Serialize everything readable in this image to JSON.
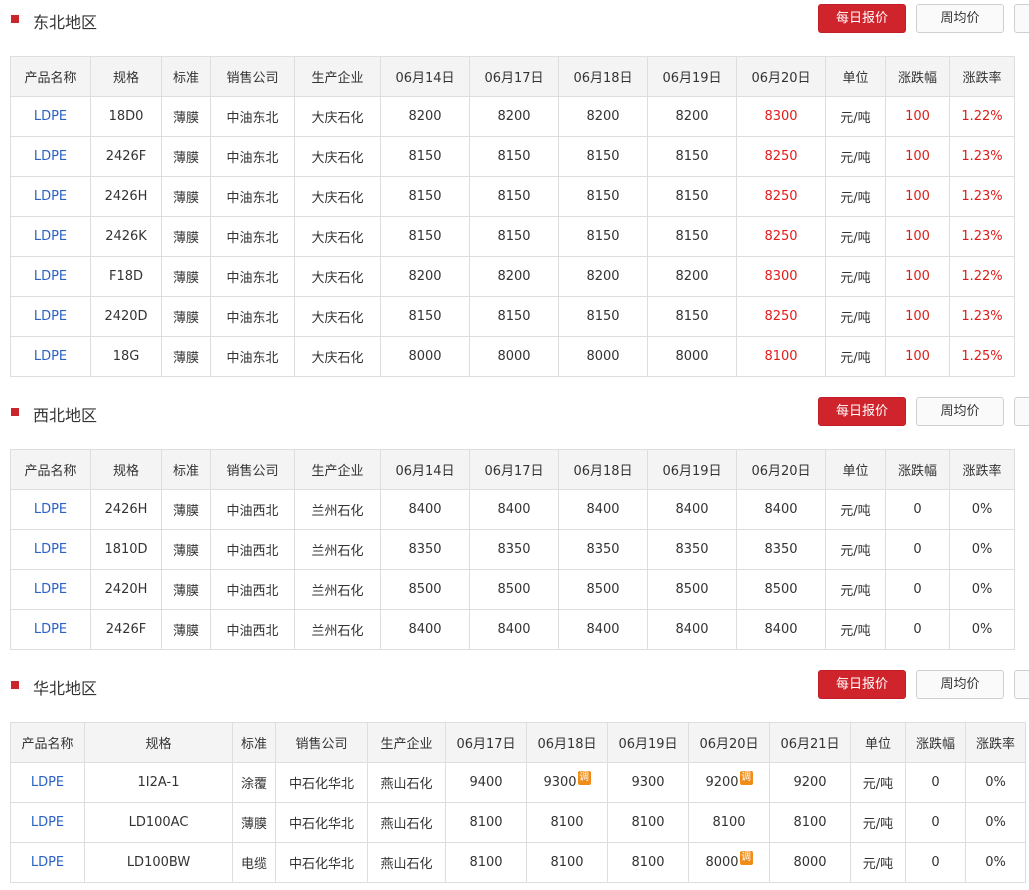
{
  "buttons": {
    "daily": "每日报价",
    "weekly": "周均价"
  },
  "sections": [
    {
      "title": "东北地区",
      "headers": [
        "产品名称",
        "规格",
        "标准",
        "销售公司",
        "生产企业",
        "06月14日",
        "06月17日",
        "06月18日",
        "06月19日",
        "06月20日",
        "单位",
        "涨跌幅",
        "涨跌率"
      ],
      "rows": [
        [
          "LDPE",
          "18D0",
          "薄膜",
          "中油东北",
          "大庆石化",
          "8200",
          "8200",
          "8200",
          "8200",
          "8300",
          "元/吨",
          "100",
          "1.22%"
        ],
        [
          "LDPE",
          "2426F",
          "薄膜",
          "中油东北",
          "大庆石化",
          "8150",
          "8150",
          "8150",
          "8150",
          "8250",
          "元/吨",
          "100",
          "1.23%"
        ],
        [
          "LDPE",
          "2426H",
          "薄膜",
          "中油东北",
          "大庆石化",
          "8150",
          "8150",
          "8150",
          "8150",
          "8250",
          "元/吨",
          "100",
          "1.23%"
        ],
        [
          "LDPE",
          "2426K",
          "薄膜",
          "中油东北",
          "大庆石化",
          "8150",
          "8150",
          "8150",
          "8150",
          "8250",
          "元/吨",
          "100",
          "1.23%"
        ],
        [
          "LDPE",
          "F18D",
          "薄膜",
          "中油东北",
          "大庆石化",
          "8200",
          "8200",
          "8200",
          "8200",
          "8300",
          "元/吨",
          "100",
          "1.22%"
        ],
        [
          "LDPE",
          "2420D",
          "薄膜",
          "中油东北",
          "大庆石化",
          "8150",
          "8150",
          "8150",
          "8150",
          "8250",
          "元/吨",
          "100",
          "1.23%"
        ],
        [
          "LDPE",
          "18G",
          "薄膜",
          "中油东北",
          "大庆石化",
          "8000",
          "8000",
          "8000",
          "8000",
          "8100",
          "元/吨",
          "100",
          "1.25%"
        ]
      ],
      "red_columns": [
        9,
        11,
        12
      ]
    },
    {
      "title": "西北地区",
      "headers": [
        "产品名称",
        "规格",
        "标准",
        "销售公司",
        "生产企业",
        "06月14日",
        "06月17日",
        "06月18日",
        "06月19日",
        "06月20日",
        "单位",
        "涨跌幅",
        "涨跌率"
      ],
      "rows": [
        [
          "LDPE",
          "2426H",
          "薄膜",
          "中油西北",
          "兰州石化",
          "8400",
          "8400",
          "8400",
          "8400",
          "8400",
          "元/吨",
          "0",
          "0%"
        ],
        [
          "LDPE",
          "1810D",
          "薄膜",
          "中油西北",
          "兰州石化",
          "8350",
          "8350",
          "8350",
          "8350",
          "8350",
          "元/吨",
          "0",
          "0%"
        ],
        [
          "LDPE",
          "2420H",
          "薄膜",
          "中油西北",
          "兰州石化",
          "8500",
          "8500",
          "8500",
          "8500",
          "8500",
          "元/吨",
          "0",
          "0%"
        ],
        [
          "LDPE",
          "2426F",
          "薄膜",
          "中油西北",
          "兰州石化",
          "8400",
          "8400",
          "8400",
          "8400",
          "8400",
          "元/吨",
          "0",
          "0%"
        ]
      ],
      "red_columns": []
    },
    {
      "title": "华北地区",
      "adjust_badge": "调",
      "headers": [
        "产品名称",
        "规格",
        "标准",
        "销售公司",
        "生产企业",
        "06月17日",
        "06月18日",
        "06月19日",
        "06月20日",
        "06月21日",
        "单位",
        "涨跌幅",
        "涨跌率"
      ],
      "rows": [
        [
          "LDPE",
          "1I2A-1",
          "涂覆",
          "中石化华北",
          "燕山石化",
          "9400",
          "9300",
          "9300",
          "9200",
          "9200",
          "元/吨",
          "0",
          "0%"
        ],
        [
          "LDPE",
          "LD100AC",
          "薄膜",
          "中石化华北",
          "燕山石化",
          "8100",
          "8100",
          "8100",
          "8100",
          "8100",
          "元/吨",
          "0",
          "0%"
        ],
        [
          "LDPE",
          "LD100BW",
          "电缆",
          "中石化华北",
          "燕山石化",
          "8100",
          "8100",
          "8100",
          "8000",
          "8000",
          "元/吨",
          "0",
          "0%"
        ]
      ],
      "adjusted_cells": [
        [
          0,
          6
        ],
        [
          0,
          8
        ],
        [
          2,
          8
        ]
      ],
      "red_columns": []
    }
  ]
}
